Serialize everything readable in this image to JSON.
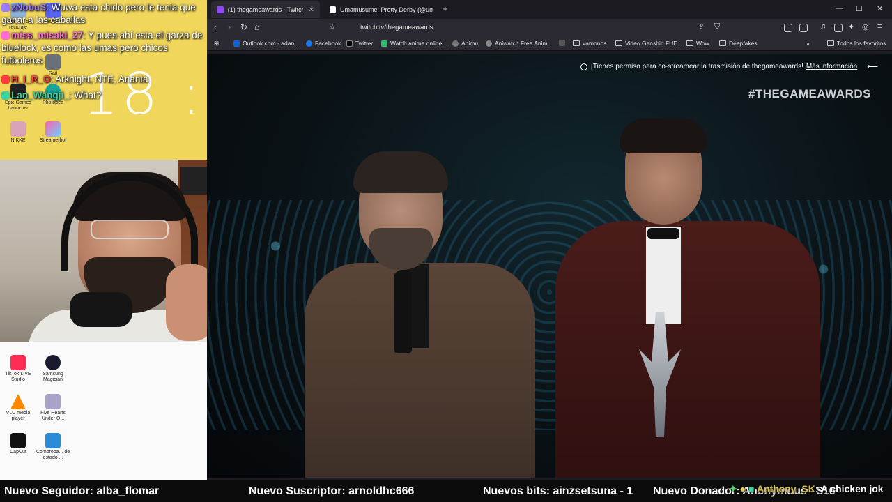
{
  "chat": {
    "messages": [
      {
        "user": "zNobuS",
        "text": "Wuwa esta chido pero le tenia que ganar a las caballas",
        "color": "#9b7bff"
      },
      {
        "user": "miss_misaki_27",
        "text": "Y pues ahí esta el garza de bluelock, es como las umas pero chicos futboleros",
        "color": "#ff6bd6"
      },
      {
        "user": "H_I_R_O",
        "text": "Arknight, NTE, Ananta",
        "color": "#ff3b3b"
      },
      {
        "user": "Lan_Wangji_",
        "text": "What?",
        "color": "#3ad29f"
      }
    ]
  },
  "desktop": {
    "clock": "18 :",
    "icons_top": [
      {
        "label": "Papelera de reciclaje",
        "icon": "recycle-bin-icon"
      },
      {
        "label": "Discord",
        "icon": "discord-icon"
      },
      {
        "label": "Rail",
        "icon": "rail-icon"
      },
      {
        "label": "Epic Games Launcher",
        "icon": "epic-games-icon"
      },
      {
        "label": "Photopea",
        "icon": "photopea-icon"
      },
      {
        "label": "NIKKE",
        "icon": "nikke-icon"
      },
      {
        "label": "Streamerbot",
        "icon": "streamerbot-icon"
      }
    ],
    "icons_bottom": [
      {
        "label": "TikTok LIVE Studio",
        "icon": "tiktok-icon"
      },
      {
        "label": "Samsung Magician",
        "icon": "samsung-magician-icon"
      },
      {
        "label": "VLC media player",
        "icon": "vlc-icon"
      },
      {
        "label": "Five Hearts Under O...",
        "icon": "five-hearts-icon"
      },
      {
        "label": "CapCut",
        "icon": "capcut-icon"
      },
      {
        "label": "Comproba... de estado ...",
        "icon": "health-check-icon"
      }
    ]
  },
  "browser": {
    "tabs": [
      {
        "title": "(1) thegameawards - Twitch",
        "active": true
      },
      {
        "title": "Umamusume: Pretty Derby (@umam",
        "active": false
      }
    ],
    "url": "twitch.tv/thegameawards",
    "bookmarks": [
      {
        "label": "Outlook.com - adan...",
        "kind": "site"
      },
      {
        "label": "Facebook",
        "kind": "site"
      },
      {
        "label": "Twitter",
        "kind": "site"
      },
      {
        "label": "Watch anime online...",
        "kind": "site"
      },
      {
        "label": "Animu",
        "kind": "site"
      },
      {
        "label": "Aniwatch Free Anim...",
        "kind": "site"
      },
      {
        "label": "vamonos",
        "kind": "folder"
      },
      {
        "label": "Video Genshin FUE...",
        "kind": "folder"
      },
      {
        "label": "Wow",
        "kind": "folder"
      },
      {
        "label": "Deepfakes",
        "kind": "folder"
      }
    ],
    "all_bookmarks": "Todos los favoritos",
    "more_bookmarks": "»"
  },
  "video": {
    "notice_text": "¡Tienes permiso para co-streamear la trasmisión de thegameawards!",
    "notice_link": "Más información",
    "hashtag": "#THEGAMEAWARDS"
  },
  "ticker": {
    "follower": "Nuevo Seguidor: alba_flomar",
    "subscriber": "Nuevo Suscriptor: arnoldhc666",
    "bits": "Nuevos bits: ainzsetsuna - 1",
    "donor": "Nuevo Donador: Anonymous - $16",
    "chat_user": "Anthony_SK",
    "chat_text": ": A chicken jok"
  }
}
